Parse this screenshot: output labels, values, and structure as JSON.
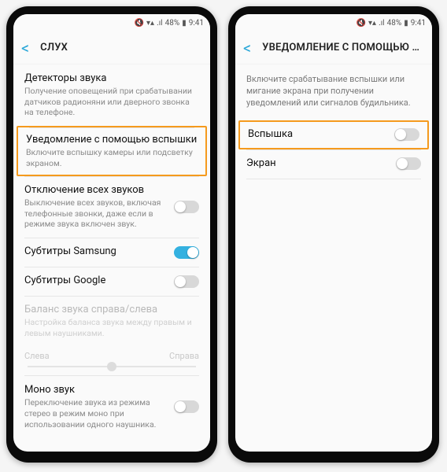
{
  "status": {
    "mute_icon": "🔇",
    "wifi_icon": "▲",
    "signal_icon": "📶",
    "battery_pct": "48%",
    "time": "9:41"
  },
  "left": {
    "title": "СЛУХ",
    "items": {
      "detectors": {
        "title": "Детекторы звука",
        "sub": "Получение оповещений при срабатывании датчиков радионяни или дверного звонка на телефоне."
      },
      "flash_notify": {
        "title": "Уведомление с помощью вспышки",
        "sub": "Включите вспышку камеры или подсветку экраном."
      },
      "mute_all": {
        "title": "Отключение всех звуков",
        "sub": "Выключение всех звуков, включая телефонные звонки, даже если в режиме звука включен звук."
      },
      "subs_samsung": {
        "title": "Субтитры Samsung"
      },
      "subs_google": {
        "title": "Субтитры Google"
      },
      "balance": {
        "title": "Баланс звука справа/слева",
        "sub": "Настройка баланса звука между правым и левым наушниками.",
        "left_label": "Слева",
        "right_label": "Справа"
      },
      "mono": {
        "title": "Моно звук",
        "sub": "Переключение звука из режима стерео в режим моно при использовании одного наушника."
      }
    }
  },
  "right": {
    "title": "УВЕДОМЛЕНИЕ С ПОМОЩЬЮ ВСПЫШКИ",
    "description": "Включите срабатывание вспышки или мигание экрана при получении уведомлений или сигналов будильника.",
    "items": {
      "flash": {
        "title": "Вспышка"
      },
      "screen": {
        "title": "Экран"
      }
    }
  }
}
